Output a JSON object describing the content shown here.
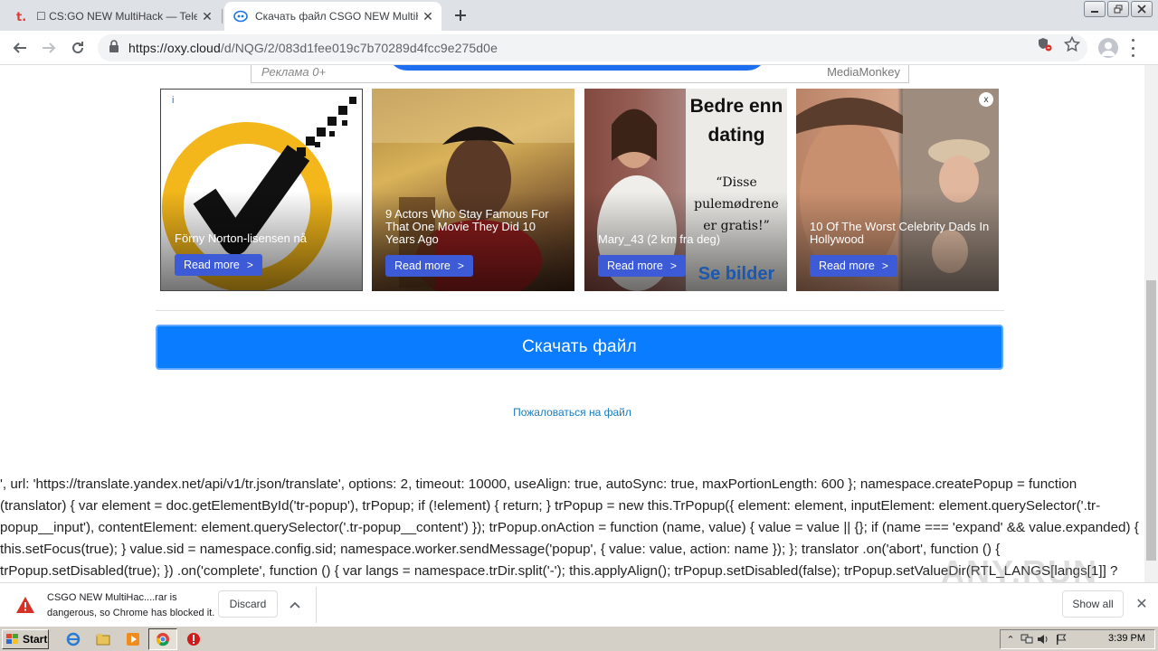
{
  "tabs": [
    {
      "title": "☐ CS:GO NEW MultiHack — Teletype",
      "active": false
    },
    {
      "title": "Скачать файл CSGO NEW MultiHack",
      "active": true
    }
  ],
  "address": {
    "host": "https://oxy.cloud",
    "path": "/d/NQG/2/083d1fee019c7b70289d4fcc9e275d0e"
  },
  "ad_banner": {
    "label": "Реклама 0+",
    "brand": "MediaMonkey"
  },
  "ads": [
    {
      "caption": "Förny Norton-lisensen nå",
      "button": "Read more",
      "badge": "i"
    },
    {
      "caption": "9 Actors Who Stay Famous For That One Movie They Did 10 Years Ago",
      "button": "Read more"
    },
    {
      "caption": "Mary_43 (2 km fra deg)",
      "button": "Read more",
      "overlay_title": "Bedre enn dating",
      "overlay_quote": "“Disse pulemødrene er gratis!”",
      "overlay_cta": "Se bilder"
    },
    {
      "caption": "10 Of The Worst Celebrity Dads In Hollywood",
      "button": "Read more",
      "badge": "x"
    }
  ],
  "download_button": "Скачать файл",
  "complain_link": "Пожаловаться на файл",
  "leaked_code": "', url: 'https://translate.yandex.net/api/v1/tr.json/translate', options: 2, timeout: 10000, useAlign: true, autoSync: true, maxPortionLength: 600 }; namespace.createPopup = function (translator) { var element = doc.getElementById('tr-popup'), trPopup; if (!element) { return; } trPopup = new this.TrPopup({ element: element, inputElement: element.querySelector('.tr-popup__input'), contentElement: element.querySelector('.tr-popup__content') }); trPopup.onAction = function (name, value) { value = value || {}; if (name === 'expand' && value.expanded) { this.setFocus(true); } value.sid = namespace.config.sid; namespace.worker.sendMessage('popup', { value: value, action: name }); }; translator .on('abort', function () { trPopup.setDisabled(true); }) .on('complete', function () { var langs = namespace.trDir.split('-'); this.applyAlign(); trPopup.setDisabled(false); trPopup.setValueDir(RTL_LANGS[langs[1]] ?",
  "download_bar": {
    "line1": "CSGO NEW MultiHac....rar is",
    "line2": "dangerous, so Chrome has blocked it.",
    "discard": "Discard",
    "show_all": "Show all"
  },
  "watermark": "ANY.RUN",
  "taskbar": {
    "start": "Start",
    "clock": "3:39 PM"
  },
  "colors": {
    "download_button": "#0a7cff",
    "ad_button": "#3d5bd6",
    "link": "#1b7bbd",
    "warning": "#d93025"
  }
}
